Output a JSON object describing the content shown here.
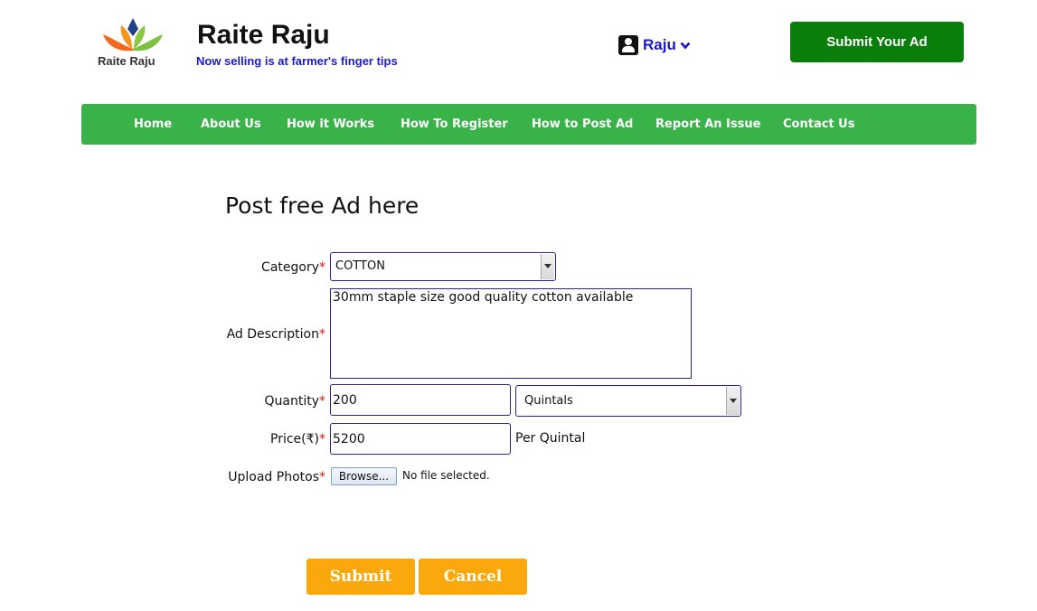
{
  "header": {
    "logo_text": "Raite Raju",
    "title": "Raite Raju",
    "tagline": "Now selling is at farmer's finger tips",
    "user_name": "Raju",
    "submit_ad_label": "Submit Your Ad"
  },
  "nav": {
    "items": [
      {
        "label": "Home"
      },
      {
        "label": "About Us"
      },
      {
        "label": "How it Works"
      },
      {
        "label": "How To Register"
      },
      {
        "label": "How to Post Ad"
      },
      {
        "label": "Report An Issue"
      },
      {
        "label": "Contact Us"
      }
    ]
  },
  "form": {
    "title": "Post free Ad here",
    "required_marker": "*",
    "category": {
      "label": "Category",
      "value": "COTTON"
    },
    "description": {
      "label": "Ad Description",
      "value": "30mm staple size good quality cotton available"
    },
    "quantity": {
      "label": "Quantity",
      "value": "200",
      "unit": "Quintals"
    },
    "price": {
      "label": "Price(₹)",
      "value": "5200",
      "suffix": "Per Quintal"
    },
    "photos": {
      "label": "Upload Photos",
      "browse_label": "Browse...",
      "status": "No file selected."
    },
    "submit_label": "Submit",
    "cancel_label": "Cancel"
  },
  "colors": {
    "nav_green": "#39b24a",
    "submit_ad_green": "#0a7e0a",
    "button_orange": "#fba80c",
    "link_blue": "#1a1acc",
    "required_red": "#d11111"
  }
}
